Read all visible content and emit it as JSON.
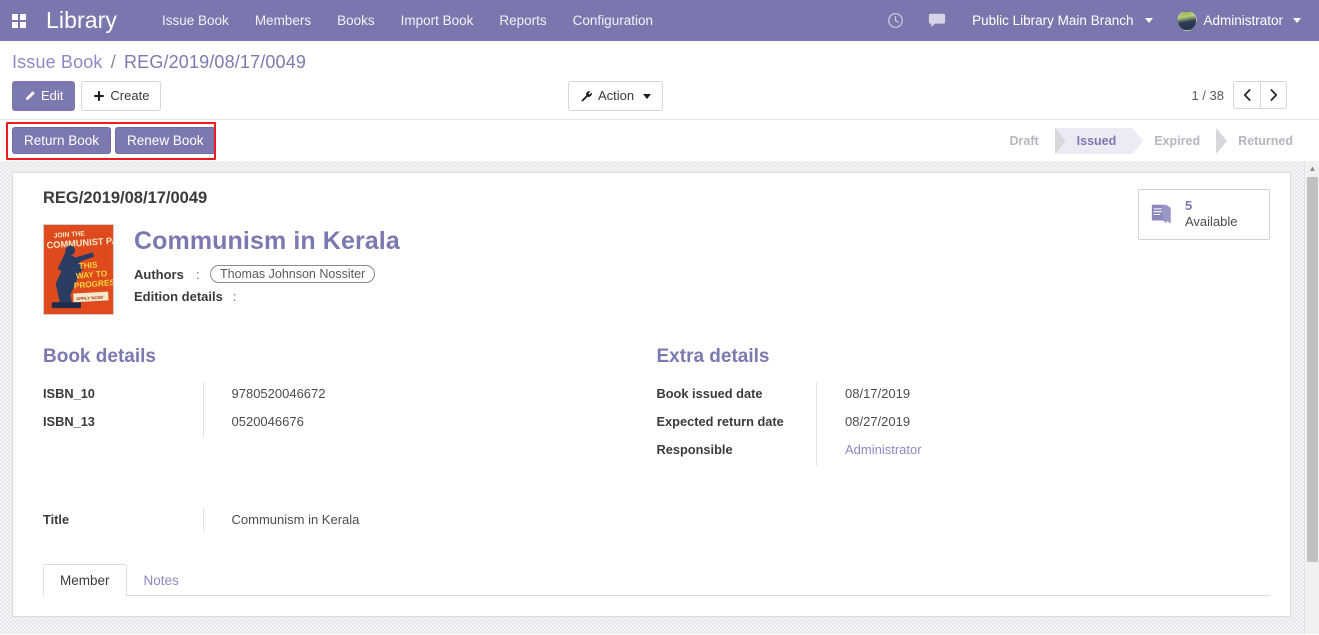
{
  "navbar": {
    "apps_icon": "apps-grid-icon",
    "brand": "Library",
    "menu": [
      {
        "label": "Issue Book"
      },
      {
        "label": "Members"
      },
      {
        "label": "Books"
      },
      {
        "label": "Import Book"
      },
      {
        "label": "Reports"
      },
      {
        "label": "Configuration"
      }
    ],
    "activity_icon": "clock-icon",
    "messages_icon": "chat-bubble-icon",
    "company": "Public Library Main Branch",
    "user": "Administrator",
    "background_color": "#7b77ae"
  },
  "control_panel": {
    "breadcrumb": {
      "root": "Issue Book",
      "separator": "/",
      "current": "REG/2019/08/17/0049"
    },
    "edit_label": "Edit",
    "edit_icon": "pencil-icon",
    "create_label": "Create",
    "create_icon": "plus-icon",
    "action_label": "Action",
    "action_icon": "wrench-icon",
    "pager_text": "1 / 38",
    "prev_icon": "chevron-left-icon",
    "next_icon": "chevron-right-icon"
  },
  "statusbar": {
    "buttons": [
      {
        "label": "Return Book"
      },
      {
        "label": "Renew Book"
      }
    ],
    "highlight_color": "#ee1c1c",
    "stages": [
      {
        "label": "Draft",
        "active": false
      },
      {
        "label": "Issued",
        "active": true
      },
      {
        "label": "Expired",
        "active": false
      },
      {
        "label": "Returned",
        "active": false
      }
    ]
  },
  "sheet": {
    "record_id": "REG/2019/08/17/0049",
    "smart_button": {
      "icon": "book-icon",
      "value": "5",
      "label": "Available"
    },
    "cover_alt": "Join the Communist Party - This Way to Progress poster",
    "book_title": "Communism in Kerala",
    "authors_label": "Authors",
    "authors_colon": ":",
    "authors": [
      "Thomas Johnson Nossiter"
    ],
    "edition_label": "Edition details",
    "edition_colon": ":",
    "edition_value": "",
    "book_details": {
      "title": "Book details",
      "rows": [
        {
          "label": "ISBN_10",
          "value": "9780520046672"
        },
        {
          "label": "ISBN_13",
          "value": "0520046676"
        }
      ]
    },
    "extra_details": {
      "title": "Extra details",
      "rows": [
        {
          "label": "Book issued date",
          "value": "08/17/2019",
          "link": false
        },
        {
          "label": "Expected return date",
          "value": "08/27/2019",
          "link": false
        },
        {
          "label": "Responsible",
          "value": "Administrator",
          "link": true
        }
      ]
    },
    "title_field": {
      "label": "Title",
      "value": "Communism in Kerala"
    },
    "notebook_tabs": [
      {
        "label": "Member",
        "active": true
      },
      {
        "label": "Notes",
        "active": false
      }
    ]
  }
}
